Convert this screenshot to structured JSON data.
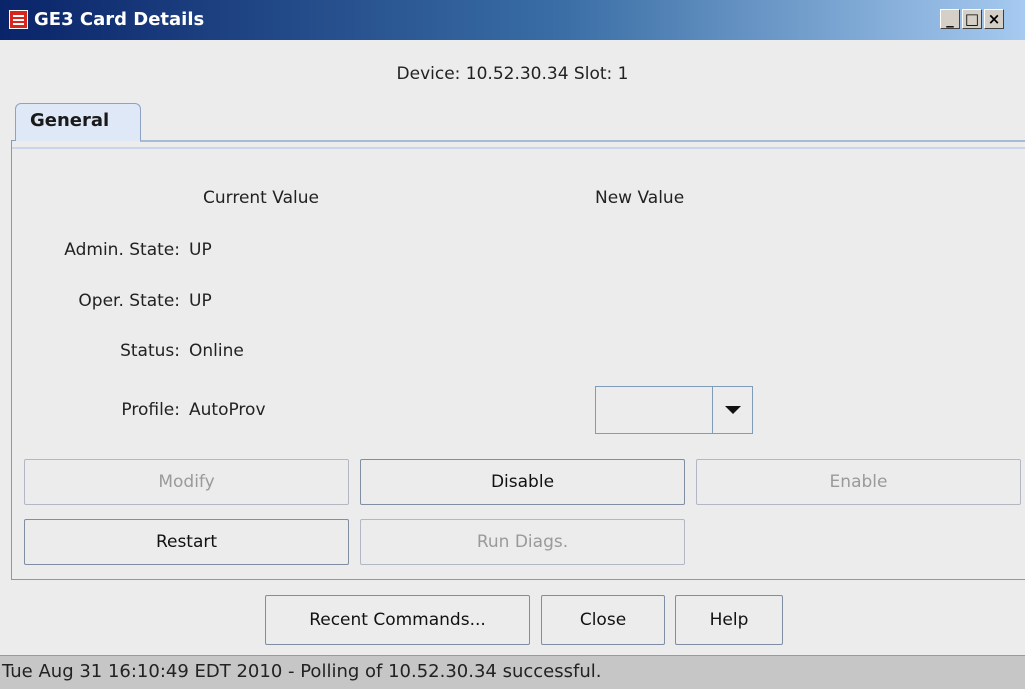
{
  "window": {
    "title": "GE3 Card Details",
    "minimize_label": "_",
    "maximize_label": "□",
    "close_label": "×"
  },
  "device_line": "Device: 10.52.30.34  Slot: 1",
  "tabs": [
    {
      "label": "General"
    }
  ],
  "columns": {
    "current": "Current Value",
    "new": "New Value"
  },
  "fields": [
    {
      "label": "Admin. State:",
      "value": "UP"
    },
    {
      "label": "Oper. State:",
      "value": "UP"
    },
    {
      "label": "Status:",
      "value": "Online"
    },
    {
      "label": "Profile:",
      "value": "AutoProv"
    }
  ],
  "profile_select": {
    "value": ""
  },
  "buttons": {
    "modify": "Modify",
    "disable": "Disable",
    "enable": "Enable",
    "restart": "Restart",
    "run_diags": "Run Diags."
  },
  "footer_buttons": {
    "recent_commands": "Recent Commands...",
    "close": "Close",
    "help": "Help"
  },
  "status_bar": "Tue Aug 31 16:10:49 EDT 2010 - Polling of 10.52.30.34 successful.",
  "icons": {
    "app": "app-icon",
    "dropdown": "chevron-down-icon"
  },
  "colors": {
    "title_start": "#0a246a",
    "title_end": "#a6caf0",
    "tab_bg": "#dfe8f6",
    "app_icon": "#d9261c"
  }
}
